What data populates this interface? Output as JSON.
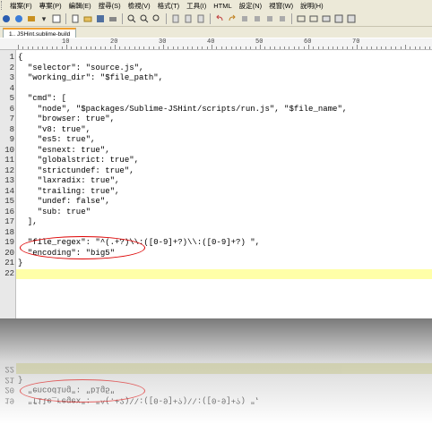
{
  "menu": [
    "檔案(F)",
    "專案(P)",
    "編輯(E)",
    "搜尋(S)",
    "檢視(V)",
    "格式(T)",
    "工具(I)",
    "HTML",
    "設定(N)",
    "視窗(W)",
    "說明(H)"
  ],
  "toolbar_icons": [
    "new-file-icon",
    "open-icon",
    "save-icon",
    "sep",
    "new-icon",
    "open-folder-icon",
    "save-disk-icon",
    "sep",
    "print-icon",
    "find-icon",
    "find-replace-icon",
    "sep",
    "bookmark-icon",
    "indent-icon",
    "sep",
    "undo-icon",
    "redo-icon",
    "cut-icon",
    "copy-icon",
    "paste-icon",
    "sep",
    "word-wrap-icon",
    "line-numbers-icon",
    "ruler-icon",
    "sep",
    "highlight-icon",
    "browser-icon"
  ],
  "tab": {
    "label": "1.. JSHint.sublime-build"
  },
  "ruler": {
    "labels": [
      "10",
      "20",
      "30",
      "40",
      "50",
      "60",
      "70"
    ]
  },
  "editor": {
    "lines": [
      {
        "n": "1",
        "text": "{"
      },
      {
        "n": "2",
        "text": "  \"selector\": \"source.js\","
      },
      {
        "n": "3",
        "text": "  \"working_dir\": \"$file_path\","
      },
      {
        "n": "4",
        "text": ""
      },
      {
        "n": "5",
        "text": "  \"cmd\": ["
      },
      {
        "n": "6",
        "text": "    \"node\", \"$packages/Sublime-JSHint/scripts/run.js\", \"$file_name\","
      },
      {
        "n": "7",
        "text": "    \"browser: true\","
      },
      {
        "n": "8",
        "text": "    \"v8: true\","
      },
      {
        "n": "9",
        "text": "    \"es5: true\","
      },
      {
        "n": "10",
        "text": "    \"esnext: true\","
      },
      {
        "n": "11",
        "text": "    \"globalstrict: true\","
      },
      {
        "n": "12",
        "text": "    \"strictundef: true\","
      },
      {
        "n": "13",
        "text": "    \"laxradix: true\","
      },
      {
        "n": "14",
        "text": "    \"trailing: true\","
      },
      {
        "n": "15",
        "text": "    \"undef: false\","
      },
      {
        "n": "16",
        "text": "    \"sub: true\""
      },
      {
        "n": "17",
        "text": "  ],"
      },
      {
        "n": "18",
        "text": ""
      },
      {
        "n": "19",
        "text": "  \"file_regex\": \"^(.+?)\\\\:([0-9]+?)\\\\:([0-9]+?) \","
      },
      {
        "n": "20",
        "text": "  \"encoding\": \"big5\""
      },
      {
        "n": "21",
        "text": "}"
      },
      {
        "n": "22",
        "text": ""
      }
    ],
    "current_line": "22"
  },
  "reflection": {
    "lines": [
      {
        "n": "22",
        "text": ""
      },
      {
        "n": "21",
        "text": "}"
      },
      {
        "n": "20",
        "text": "  \"encoding\": \"big5\""
      },
      {
        "n": "19",
        "text": "  \"file_regex\": \"^(.+?)\\\\:([0-9]+?)\\\\:([0-9]+?) \","
      }
    ]
  }
}
